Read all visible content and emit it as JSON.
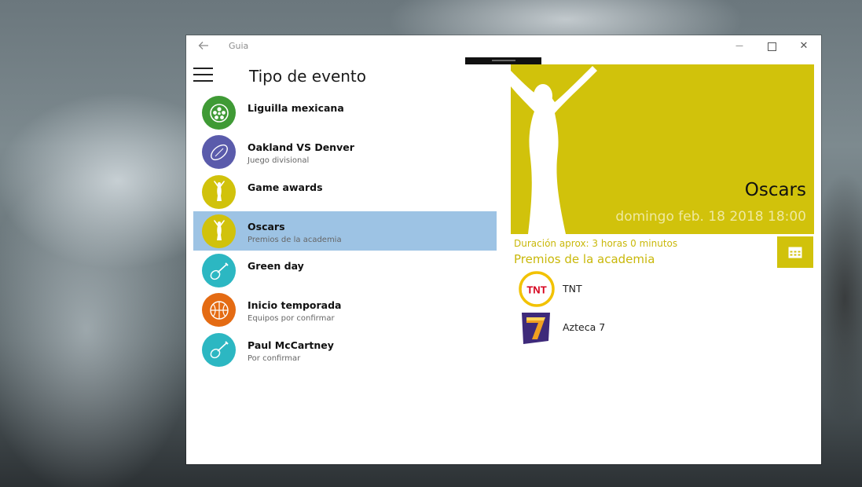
{
  "app": {
    "title": "Guia",
    "back_icon": "back-arrow-icon",
    "controls": {
      "minimize": "—",
      "close": "✕"
    }
  },
  "pane": {
    "title": "Tipo de evento",
    "menu_icon": "hamburger-menu-icon"
  },
  "events": [
    {
      "title": "Liguilla mexicana",
      "subtitle": "",
      "icon": "soccer-ball-icon",
      "color": "#3f9a35"
    },
    {
      "title": "Oakland VS Denver",
      "subtitle": "Juego divisional",
      "icon": "football-icon",
      "color": "#5a5bab"
    },
    {
      "title": "Game awards",
      "subtitle": "",
      "icon": "trophy-statue-icon",
      "color": "#d1c20b"
    },
    {
      "title": "Oscars",
      "subtitle": "Premios de la academia",
      "icon": "trophy-statue-icon",
      "color": "#d1c20b",
      "selected": true
    },
    {
      "title": "Green day",
      "subtitle": "",
      "icon": "guitar-icon",
      "color": "#2cb7c2"
    },
    {
      "title": "Inicio temporada",
      "subtitle": "Equipos por confirmar",
      "icon": "basketball-icon",
      "color": "#e46b13"
    },
    {
      "title": "Paul McCartney",
      "subtitle": "Por confirmar",
      "icon": "guitar-icon",
      "color": "#2cb7c2"
    }
  ],
  "detail": {
    "title": "Oscars",
    "date": "domingo feb. 18 2018 18:00",
    "duration": "Duración aprox: 3 horas 0 minutos",
    "subtitle": "Premios de la academia",
    "accent_color": "#d1c20b",
    "calendar_icon": "calendar-icon",
    "channels": [
      {
        "name": "TNT",
        "logo": "tnt-logo"
      },
      {
        "name": "Azteca 7",
        "logo": "azteca-7-logo"
      }
    ]
  }
}
